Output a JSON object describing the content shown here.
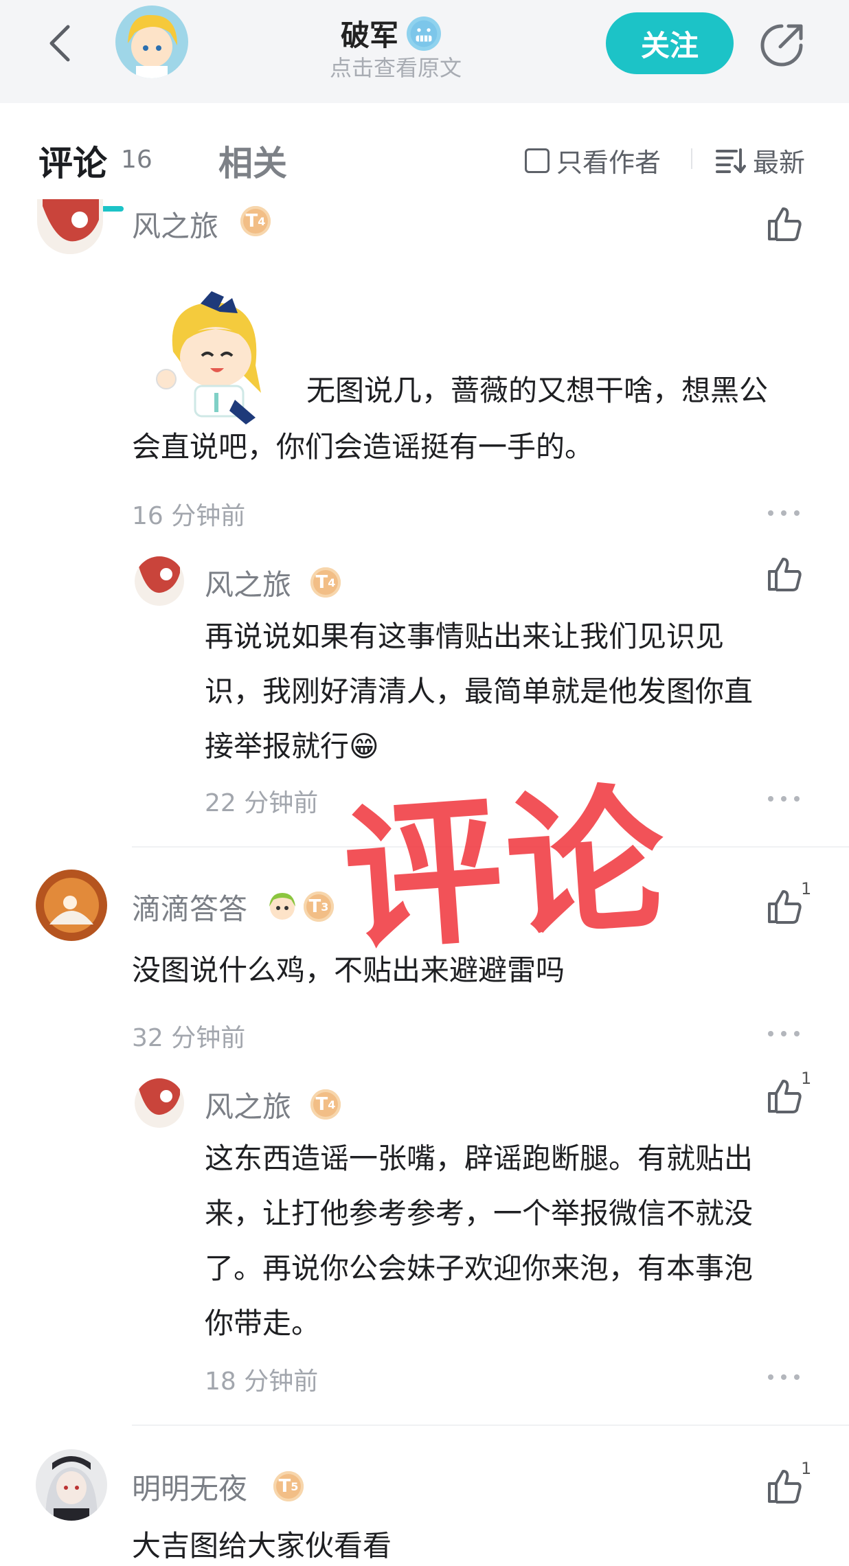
{
  "header": {
    "title": "破军",
    "subtitle": "点击查看原文",
    "follow_label": "关注",
    "title_emoji": "cold-face-emoji"
  },
  "tabs": {
    "comments_label": "评论",
    "comments_count": "16",
    "related_label": "相关",
    "only_author_label": "只看作者",
    "sort_label": "最新"
  },
  "comments": [
    {
      "user": "风之旅",
      "level": "T4",
      "text_line1": "无图说几，蔷薇的又想干啥，想黑公",
      "text_line2": "会直说吧，你们会造谣挺有一手的。",
      "time": "16 分钟前",
      "replies": [
        {
          "user": "风之旅",
          "level": "T4",
          "lines": [
            "再说说如果有这事情贴出来让我们见识见",
            "识，我刚好清清人，最简单就是他发图你直",
            "接举报就行😁"
          ],
          "time": "22 分钟前"
        }
      ]
    },
    {
      "user": "滴滴答答",
      "level": "T3",
      "likes": "1",
      "text": "没图说什么鸡，不贴出来避避雷吗",
      "time": "32 分钟前",
      "replies": [
        {
          "user": "风之旅",
          "level": "T4",
          "likes": "1",
          "lines": [
            "这东西造谣一张嘴，辟谣跑断腿。有就贴出",
            "来，让打他参考参考，一个举报微信不就没",
            "了。再说你公会妹子欢迎你来泡，有本事泡",
            "你带走。"
          ],
          "time": "18 分钟前"
        }
      ]
    },
    {
      "user": "明明无夜",
      "level": "T5",
      "likes": "1",
      "text": "大吉图给大家伙看看"
    }
  ],
  "watermark": "评论",
  "colors": {
    "accent": "#1cc3c7",
    "stamp": "#f0343c",
    "level_badge": "#f2be86"
  }
}
